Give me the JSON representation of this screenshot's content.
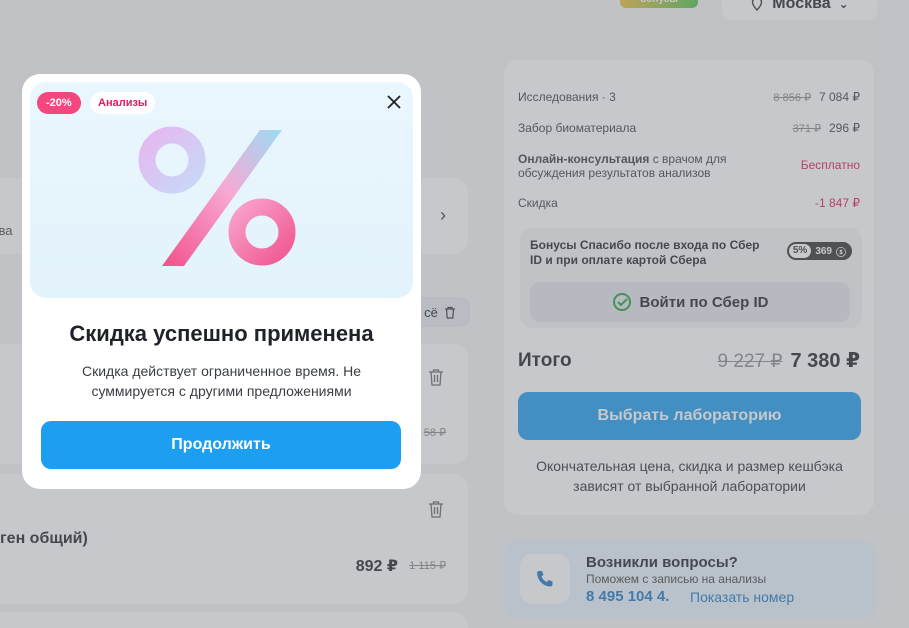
{
  "header": {
    "brand_badge": "бонусы",
    "city": "Москва"
  },
  "cart": {
    "item1_partial_text": "в ва",
    "clear_label": "сё",
    "item2_old_price": "58 ₽",
    "item3_name": "ген общий)",
    "item3_price": "892 ₽",
    "item3_old_price": "1 115 ₽"
  },
  "summary": {
    "rows": [
      {
        "label": "Исследования · 3",
        "old": "8 856 ₽",
        "value": "7 084 ₽"
      },
      {
        "label": "Забор биоматериала",
        "old": "371 ₽",
        "value": "296 ₽"
      },
      {
        "label_bold": "Онлайн-консультация",
        "label_rest": " с врачом для обсуждения результатов анализов",
        "value": "Бесплатно"
      },
      {
        "label": "Скидка",
        "value": "-1 847 ₽"
      }
    ],
    "bonus_text": "Бонусы Спасибо после входа по Сбер ID и при оплате картой Сбера",
    "bonus_pct": "5%",
    "bonus_amount": "369",
    "sber_login": "Войти по Сбер ID",
    "total_label": "Итого",
    "total_old": "9 227 ₽",
    "total_new": "7 380 ₽",
    "choose_lab": "Выбрать лабораторию",
    "final_note": "Окончательная цена, скидка и размер кешбэка зависят от выбранной лаборатории"
  },
  "help": {
    "title": "Возникли вопросы?",
    "subtitle": "Поможем с записью на анализы",
    "phone": "8 495 104 4.",
    "show_number": "Показать номер"
  },
  "modal": {
    "discount_tag": "-20%",
    "category_tag": "Анализы",
    "title": "Скидка успешно применена",
    "description": "Скидка действует ограниченное время. Не суммируется с другими предложениями",
    "continue": "Продолжить"
  },
  "colors": {
    "accent": "#1e9ef0",
    "discount": "#f4477d",
    "negative": "#e0145a",
    "sber": "#21a038"
  }
}
